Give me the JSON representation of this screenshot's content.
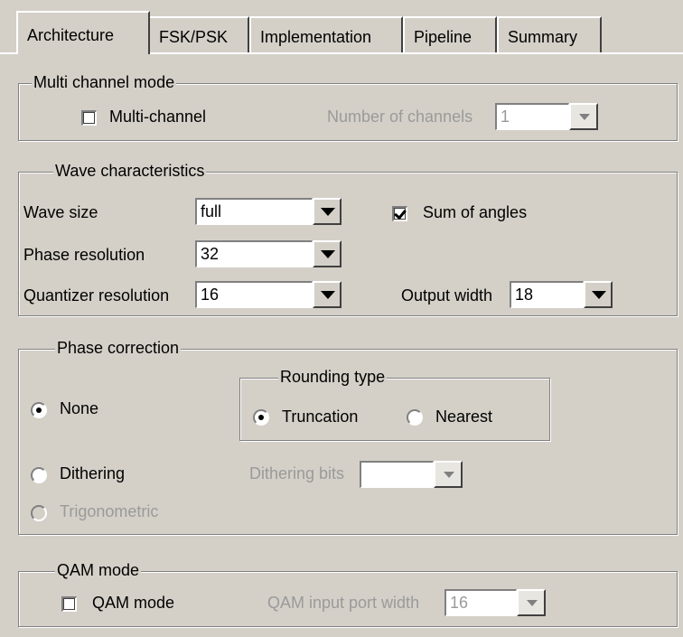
{
  "tabs": [
    "Architecture",
    "FSK/PSK",
    "Implementation",
    "Pipeline",
    "Summary"
  ],
  "multi_channel": {
    "title": "Multi channel mode",
    "checkbox_label": "Multi-channel",
    "checked": false,
    "channels_label": "Number of channels",
    "channels_value": "1"
  },
  "wave": {
    "title": "Wave characteristics",
    "wave_size_label": "Wave size",
    "wave_size_value": "full",
    "sum_of_angles_label": "Sum of angles",
    "sum_of_angles_checked": true,
    "phase_resolution_label": "Phase resolution",
    "phase_resolution_value": "32",
    "quantizer_resolution_label": "Quantizer resolution",
    "quantizer_resolution_value": "16",
    "output_width_label": "Output width",
    "output_width_value": "18"
  },
  "phase_correction": {
    "title": "Phase correction",
    "none_label": "None",
    "dithering_label": "Dithering",
    "trigonometric_label": "Trigonometric",
    "selected": "None",
    "rounding": {
      "title": "Rounding type",
      "truncation_label": "Truncation",
      "nearest_label": "Nearest",
      "selected": "Truncation"
    },
    "dithering_bits_label": "Dithering bits",
    "dithering_bits_value": ""
  },
  "qam": {
    "title": "QAM mode",
    "checkbox_label": "QAM mode",
    "checked": false,
    "port_width_label": "QAM input port width",
    "port_width_value": "16"
  }
}
